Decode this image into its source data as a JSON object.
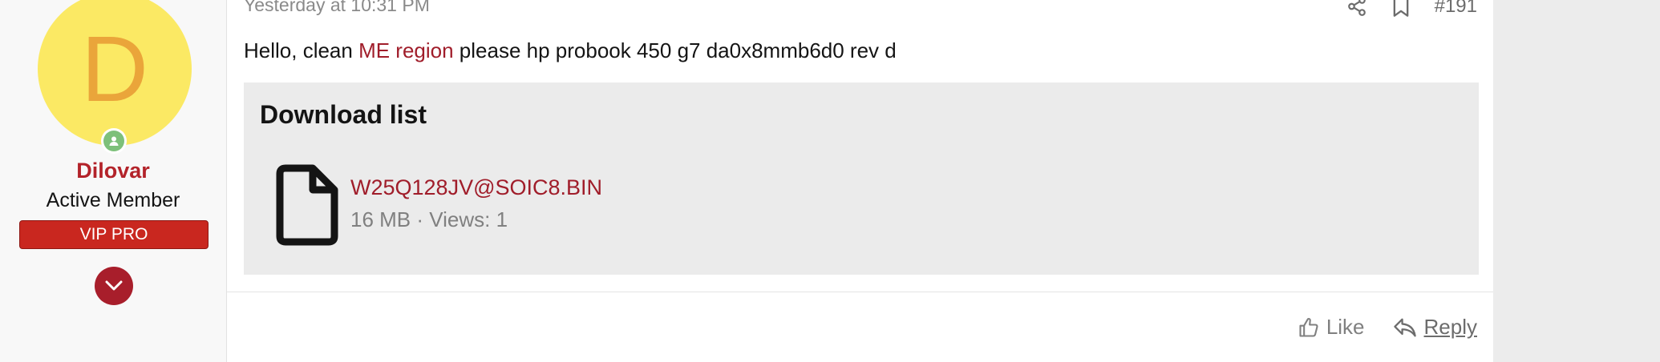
{
  "user": {
    "avatar_letter": "D",
    "name": "Dilovar",
    "title": "Active Member",
    "banner": "VIP PRO",
    "colors": {
      "avatar_bg": "#fbe964",
      "avatar_letter": "#eaa53a",
      "name": "#b3232a",
      "banner_bg": "#c9271f",
      "online": "#7dc07a"
    }
  },
  "post": {
    "date": "Yesterday at 10:31 PM",
    "number": "#191",
    "message": {
      "before": "Hello, clean ",
      "link": "ME region",
      "after": " please hp probook 450 g7 da0x8mmb6d0 rev d"
    }
  },
  "downloads": {
    "title": "Download list",
    "files": [
      {
        "name": "W25Q128JV@SOIC8.BIN",
        "meta": "16 MB · Views: 1",
        "icon": "file-icon"
      }
    ]
  },
  "actions": {
    "like": "Like",
    "reply": "Reply"
  },
  "icons": [
    "share-icon",
    "bookmark-icon",
    "chevron-down-icon",
    "thumbs-up-icon",
    "reply-icon",
    "file-icon",
    "online-status-icon"
  ]
}
